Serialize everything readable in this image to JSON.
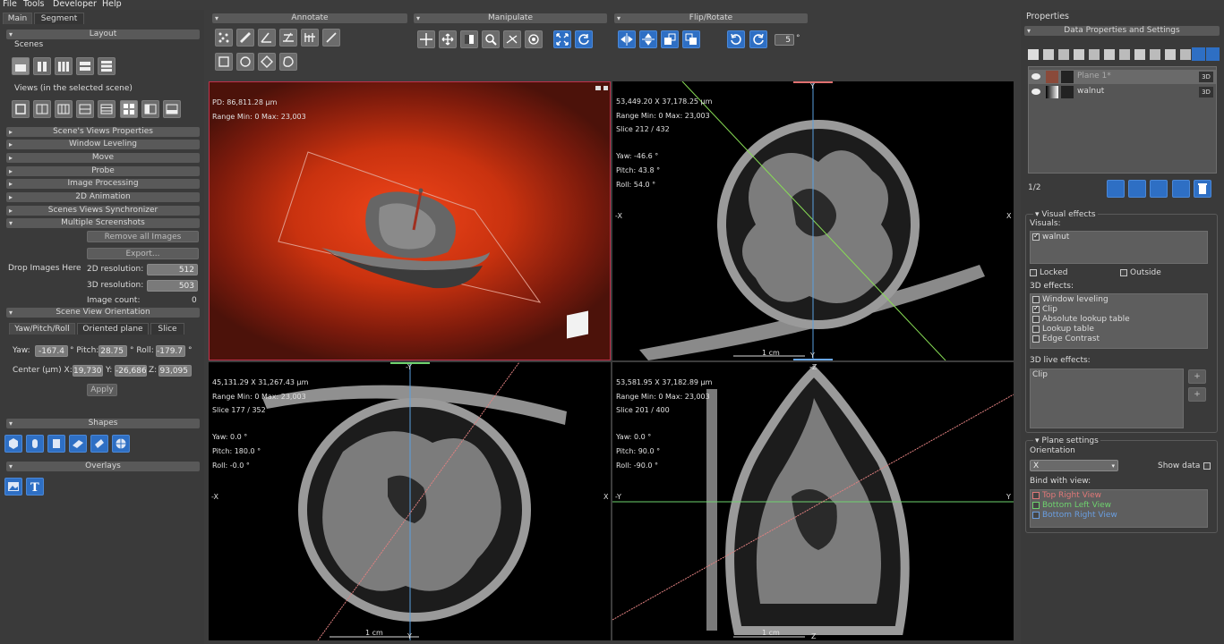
{
  "menu": [
    "File",
    "Tools",
    "Developer",
    "Help"
  ],
  "left": {
    "tabs": [
      "Main",
      "Segment"
    ],
    "layout": "Layout",
    "scenes_label": "Scenes",
    "views_label": "Views (in the selected scene)",
    "sections": [
      "Scene's Views Properties",
      "Window Leveling",
      "Move",
      "Probe",
      "Image Processing",
      "2D Animation",
      "Scenes Views Synchronizer",
      "Multiple Screenshots"
    ],
    "remove_all": "Remove all Images",
    "export": "Export...",
    "drop_images": "Drop Images Here",
    "res2d_label": "2D resolution:",
    "res2d": "512",
    "res3d_label": "3D resolution:",
    "res3d": "503",
    "image_count_label": "Image count:",
    "image_count": "0",
    "orientation": "Scene View Orientation",
    "orient_tabs": [
      "Yaw/Pitch/Roll",
      "Oriented plane",
      "Slice"
    ],
    "yaw_label": "Yaw:",
    "yaw": "-167.4",
    "pitch_label": "° Pitch:",
    "pitch": "28.75",
    "roll_label": "° Roll:",
    "roll": "-179.7",
    "roll_unit": "°",
    "center_label": "Center (µm) X:",
    "cx": "19,730",
    "cy_label": "Y:",
    "cy": "-26,686",
    "cz_label": "Z:",
    "cz": "93,095",
    "apply": "Apply",
    "shapes": "Shapes",
    "overlays": "Overlays"
  },
  "toolbar": {
    "annotate": "Annotate",
    "manipulate": "Manipulate",
    "flip_rotate": "Flip/Rotate",
    "rotate_step": "5",
    "rotate_unit": "°"
  },
  "views": {
    "tl": {
      "line1": "PD: 86,811.28  µm",
      "line2": "Range  Min: 0  Max: 23,003"
    },
    "tr": {
      "coords": "53,449.20  X  37,178.25  µm",
      "range": "Range  Min: 0  Max: 23,003",
      "slice": "Slice  212  /  432",
      "yaw": "Yaw:  -46.6  °",
      "pitch": "Pitch:  43.8  °",
      "roll": "Roll:  54.0  °",
      "scale": "1 cm",
      "top": "Y",
      "bottom": "Y",
      "left": "-X",
      "right": "X"
    },
    "bl": {
      "coords": "45,131.29  X  31,267.43  µm",
      "range": "Range  Min: 0  Max: 23,003",
      "slice": "Slice  177  /  352",
      "yaw": "Yaw:  0.0  °",
      "pitch": "Pitch:  180.0  °",
      "roll": "Roll:  -0.0  °",
      "scale": "1 cm",
      "top": "-Y",
      "bottom": "Y",
      "left": "-X",
      "right": "X"
    },
    "br": {
      "coords": "53,581.95  X  37,182.89  µm",
      "range": "Range  Min: 0  Max: 23,003",
      "slice": "Slice  201  /  400",
      "yaw": "Yaw:  0.0  °",
      "pitch": "Pitch:  90.0  °",
      "roll": "Roll:  -90.0  °",
      "scale": "1 cm",
      "top": "-Z",
      "bottom": "Z",
      "left": "-Y",
      "right": "Y"
    }
  },
  "right": {
    "title": "Properties",
    "data_props": "Data Properties and Settings",
    "layers": [
      {
        "name": "Plane 1*",
        "tag": "3D"
      },
      {
        "name": "walnut",
        "tag": "3D"
      }
    ],
    "page": "1/2",
    "visual_effects": "Visual effects",
    "visuals_label": "Visuals:",
    "visuals": [
      "walnut"
    ],
    "locked": "Locked",
    "outside": "Outside",
    "effects3d_label": "3D effects:",
    "effects3d": [
      {
        "name": "Window leveling",
        "on": false
      },
      {
        "name": "Clip",
        "on": true
      },
      {
        "name": "Absolute lookup table",
        "on": false
      },
      {
        "name": "Lookup table",
        "on": false
      },
      {
        "name": "Edge Contrast",
        "on": false
      }
    ],
    "live_label": "3D live effects:",
    "live": [
      "Clip"
    ],
    "plane_settings": "Plane settings",
    "orientation_label": "Orientation",
    "orientation": "X",
    "show_data": "Show data",
    "bind_label": "Bind with view:",
    "bind": [
      {
        "name": "Top Right View",
        "color": "#e07878"
      },
      {
        "name": "Bottom Left View",
        "color": "#6ed26e"
      },
      {
        "name": "Bottom Right View",
        "color": "#6a9ee0"
      }
    ]
  }
}
